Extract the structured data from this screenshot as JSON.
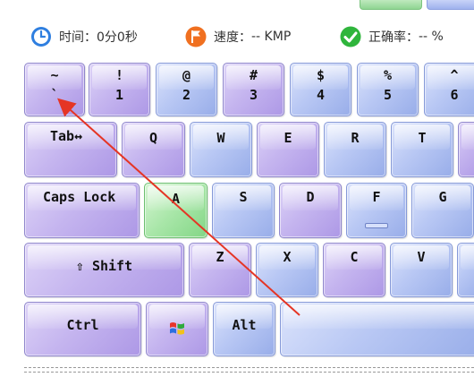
{
  "stats": {
    "time": {
      "label": "时间：",
      "value": "0分0秒",
      "icon": "clock-icon",
      "color": "#2f7fe0"
    },
    "speed": {
      "label": "速度：",
      "value": "-- KMP",
      "icon": "flag-icon",
      "color": "#f07020"
    },
    "accuracy": {
      "label": "正确率：",
      "value": "-- %",
      "icon": "check-icon",
      "color": "#2fb53c"
    }
  },
  "keyboard": {
    "row1": [
      {
        "top": "~",
        "bottom": "`"
      },
      {
        "top": "!",
        "bottom": "1"
      },
      {
        "top": "@",
        "bottom": "2"
      },
      {
        "top": "#",
        "bottom": "3"
      },
      {
        "top": "$",
        "bottom": "4"
      },
      {
        "top": "%",
        "bottom": "5"
      },
      {
        "top": "^",
        "bottom": "6"
      }
    ],
    "row2": [
      "Tab↔",
      "Q",
      "W",
      "E",
      "R",
      "T",
      ""
    ],
    "row3": [
      "Caps Lock",
      "A",
      "S",
      "D",
      "F",
      "G",
      ""
    ],
    "row4": [
      "⇧ Shift",
      "Z",
      "X",
      "C",
      "V",
      ""
    ],
    "row5": {
      "ctrl": "Ctrl",
      "win": "windows-logo-icon",
      "alt": "Alt",
      "space": ""
    }
  },
  "colors": {
    "purple": "#c5b5ef",
    "blue": "#b9c8f4",
    "green": "#a8e6a8",
    "arrow": "#e53525"
  }
}
